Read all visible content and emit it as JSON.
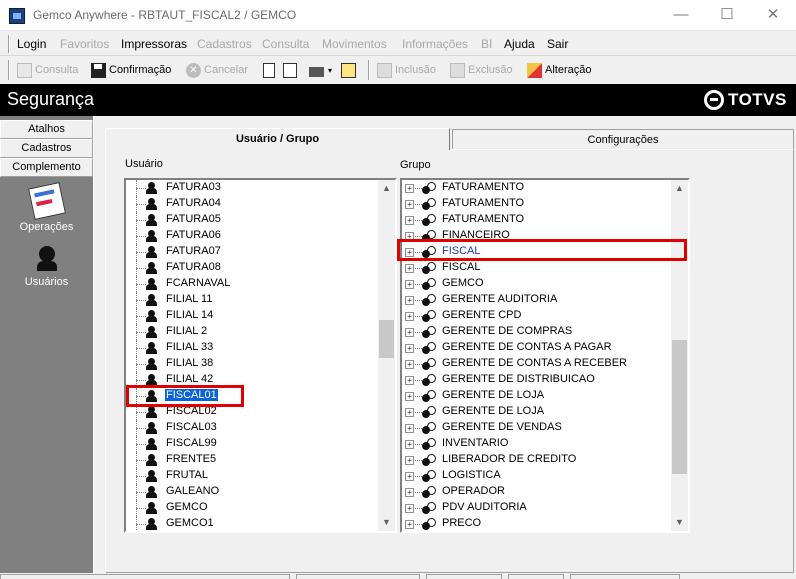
{
  "window": {
    "title": "Gemco Anywhere - RBTAUT_FISCAL2 / GEMCO",
    "min_glyph": "—",
    "max_glyph": "☐",
    "close_glyph": "✕"
  },
  "menu": [
    {
      "label": "Login",
      "enabled": true
    },
    {
      "label": "Favoritos",
      "enabled": false
    },
    {
      "label": "Impressoras",
      "enabled": true
    },
    {
      "label": "Cadastros",
      "enabled": false
    },
    {
      "label": "Consulta",
      "enabled": false
    },
    {
      "label": "Movimentos",
      "enabled": false
    },
    {
      "label": "Informações",
      "enabled": false
    },
    {
      "label": "BI",
      "enabled": false
    },
    {
      "label": "Ajuda",
      "enabled": true
    },
    {
      "label": "Sair",
      "enabled": true
    }
  ],
  "toolbar": {
    "consulta": "Consulta",
    "confirmacao": "Confirmação",
    "cancelar": "Cancelar",
    "inclusao": "Inclusão",
    "exclusao": "Exclusão",
    "alteracao": "Alteração",
    "cancel_glyph": "✕",
    "dropdown_glyph": "▾"
  },
  "header": {
    "title": "Segurança",
    "brand": "TOTVS"
  },
  "leftnav": {
    "tabs": [
      "Atalhos",
      "Cadastros",
      "Complemento"
    ],
    "launchers": [
      {
        "label": "Operações",
        "icon": "operations-icon"
      },
      {
        "label": "Usuários",
        "icon": "users-icon"
      }
    ]
  },
  "tabs": {
    "active": "Usuário  / Grupo",
    "inactive": "Configurações"
  },
  "usuario_panel": {
    "label": "Usuário",
    "items": [
      "FATURA03",
      "FATURA04",
      "FATURA05",
      "FATURA06",
      "FATURA07",
      "FATURA08",
      "FCARNAVAL",
      "FILIAL 11",
      "FILIAL 14",
      "FILIAL 2",
      "FILIAL 33",
      "FILIAL 38",
      "FILIAL 42",
      "FISCAL01",
      "FISCAL02",
      "FISCAL03",
      "FISCAL99",
      "FRENTE5",
      "FRUTAL",
      "GALEANO",
      "GEMCO",
      "GEMCO1"
    ],
    "selected": "FISCAL01"
  },
  "grupo_panel": {
    "label": "Grupo",
    "items": [
      "FATURAMENTO",
      "FATURAMENTO",
      "FATURAMENTO",
      "FINANCEIRO",
      "FISCAL",
      "FISCAL",
      "GEMCO",
      "GERENTE AUDITORIA",
      "GERENTE CPD",
      "GERENTE DE COMPRAS",
      "GERENTE DE CONTAS A PAGAR",
      "GERENTE DE CONTAS A RECEBER",
      "GERENTE DE DISTRIBUICAO",
      "GERENTE DE LOJA",
      "GERENTE DE LOJA",
      "GERENTE DE VENDAS",
      "INVENTARIO",
      "LIBERADOR DE CREDITO",
      "LOGISTICA",
      "OPERADOR",
      "PDV AUDITORIA",
      "PRECO"
    ],
    "focused": "FISCAL"
  },
  "scroll": {
    "up_glyph": "▲",
    "down_glyph": "▼"
  },
  "colors": {
    "selection": "#0a64d8",
    "annotation": "#e00000",
    "header_bg": "#000000"
  }
}
